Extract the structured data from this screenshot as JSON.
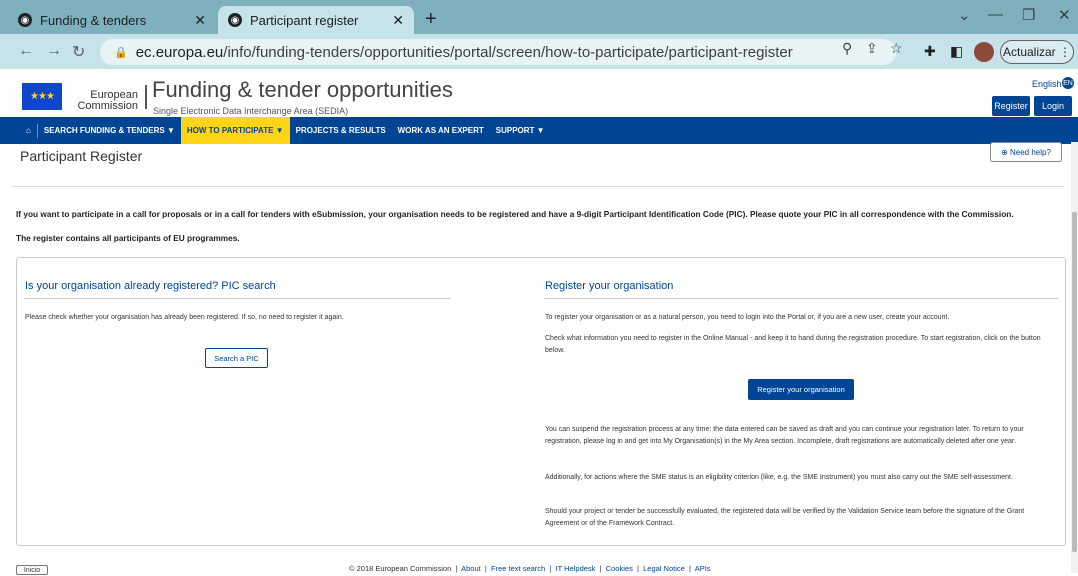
{
  "browser": {
    "tabs": [
      {
        "title": "Funding & tenders",
        "active": false
      },
      {
        "title": "Participant register",
        "active": true
      }
    ],
    "new_tab": "+",
    "url_domain": "ec.europa.eu",
    "url_path": "/info/funding-tenders/opportunities/portal/screen/how-to-participate/participant-register",
    "update_label": "Actualizar",
    "icons": [
      "back-icon",
      "forward-icon",
      "reload-icon",
      "lock-icon",
      "zoom-icon",
      "share-icon",
      "star-icon",
      "extensions-icon",
      "sidepanel-icon",
      "profile-avatar",
      "menu-icon"
    ]
  },
  "site": {
    "ec_line1": "European",
    "ec_line2": "Commission",
    "title": "Funding & tender opportunities",
    "subtitle": "Single Electronic Data Interchange Area (SEDIA)",
    "language": "English",
    "lang_code": "EN",
    "register_label": "Register",
    "login_label": "Login"
  },
  "nav": {
    "items": [
      {
        "label": "SEARCH FUNDING & TENDERS",
        "dropdown": true,
        "active": false
      },
      {
        "label": "HOW TO PARTICIPATE",
        "dropdown": true,
        "active": true
      },
      {
        "label": "PROJECTS & RESULTS",
        "dropdown": false,
        "active": false
      },
      {
        "label": "WORK AS AN EXPERT",
        "dropdown": false,
        "active": false
      },
      {
        "label": "SUPPORT",
        "dropdown": true,
        "active": false
      }
    ]
  },
  "page": {
    "title": "Participant Register",
    "help_label": "Need help?",
    "intro1": "If you want to participate in a call for proposals or in a call for tenders with eSubmission, your organisation needs to be registered and have a 9-digit Participant Identification Code (PIC). Please quote your PIC in all correspondence with the Commission.",
    "intro2": "The register contains all participants of EU programmes."
  },
  "left": {
    "title": "Is your organisation already registered? PIC search",
    "text": "Please check whether your organisation has already been registered. If so, no need to register it again.",
    "button": "Search a PIC"
  },
  "right": {
    "title": "Register your organisation",
    "p1": "To register your organisation or as a natural person, you need to login into the Portal or, if you are a new user, create your account.",
    "p2": "Check what information you need to register in the Online Manual - and keep it to hand during the registration procedure. To start registration, click on the button below.",
    "button": "Register your organisation",
    "p3": "You can suspend the registration process at any time: the data entered can be saved as draft and you can continue your registration later. To return to your registration, please log in and get into My Organisation(s) in the My Area section. Incomplete, draft registrations are automatically deleted after one year.",
    "p4": "Additionally, for actions where the SME status is an eligibility criterion (like, e.g. the SME Instrument) you must also carry out the SME self-assessment.",
    "p5": "Should your project or tender be successfully evaluated, the registered data will be verified by the Validation Service team before the signature of the Grant Agreement or of the Framework Contract."
  },
  "footer": {
    "copyright": "© 2018 European Commission",
    "links": [
      "About",
      "Free text search",
      "IT Helpdesk",
      "Cookies",
      "Legal Notice",
      "APIs"
    ],
    "inicio": "Inicio"
  }
}
